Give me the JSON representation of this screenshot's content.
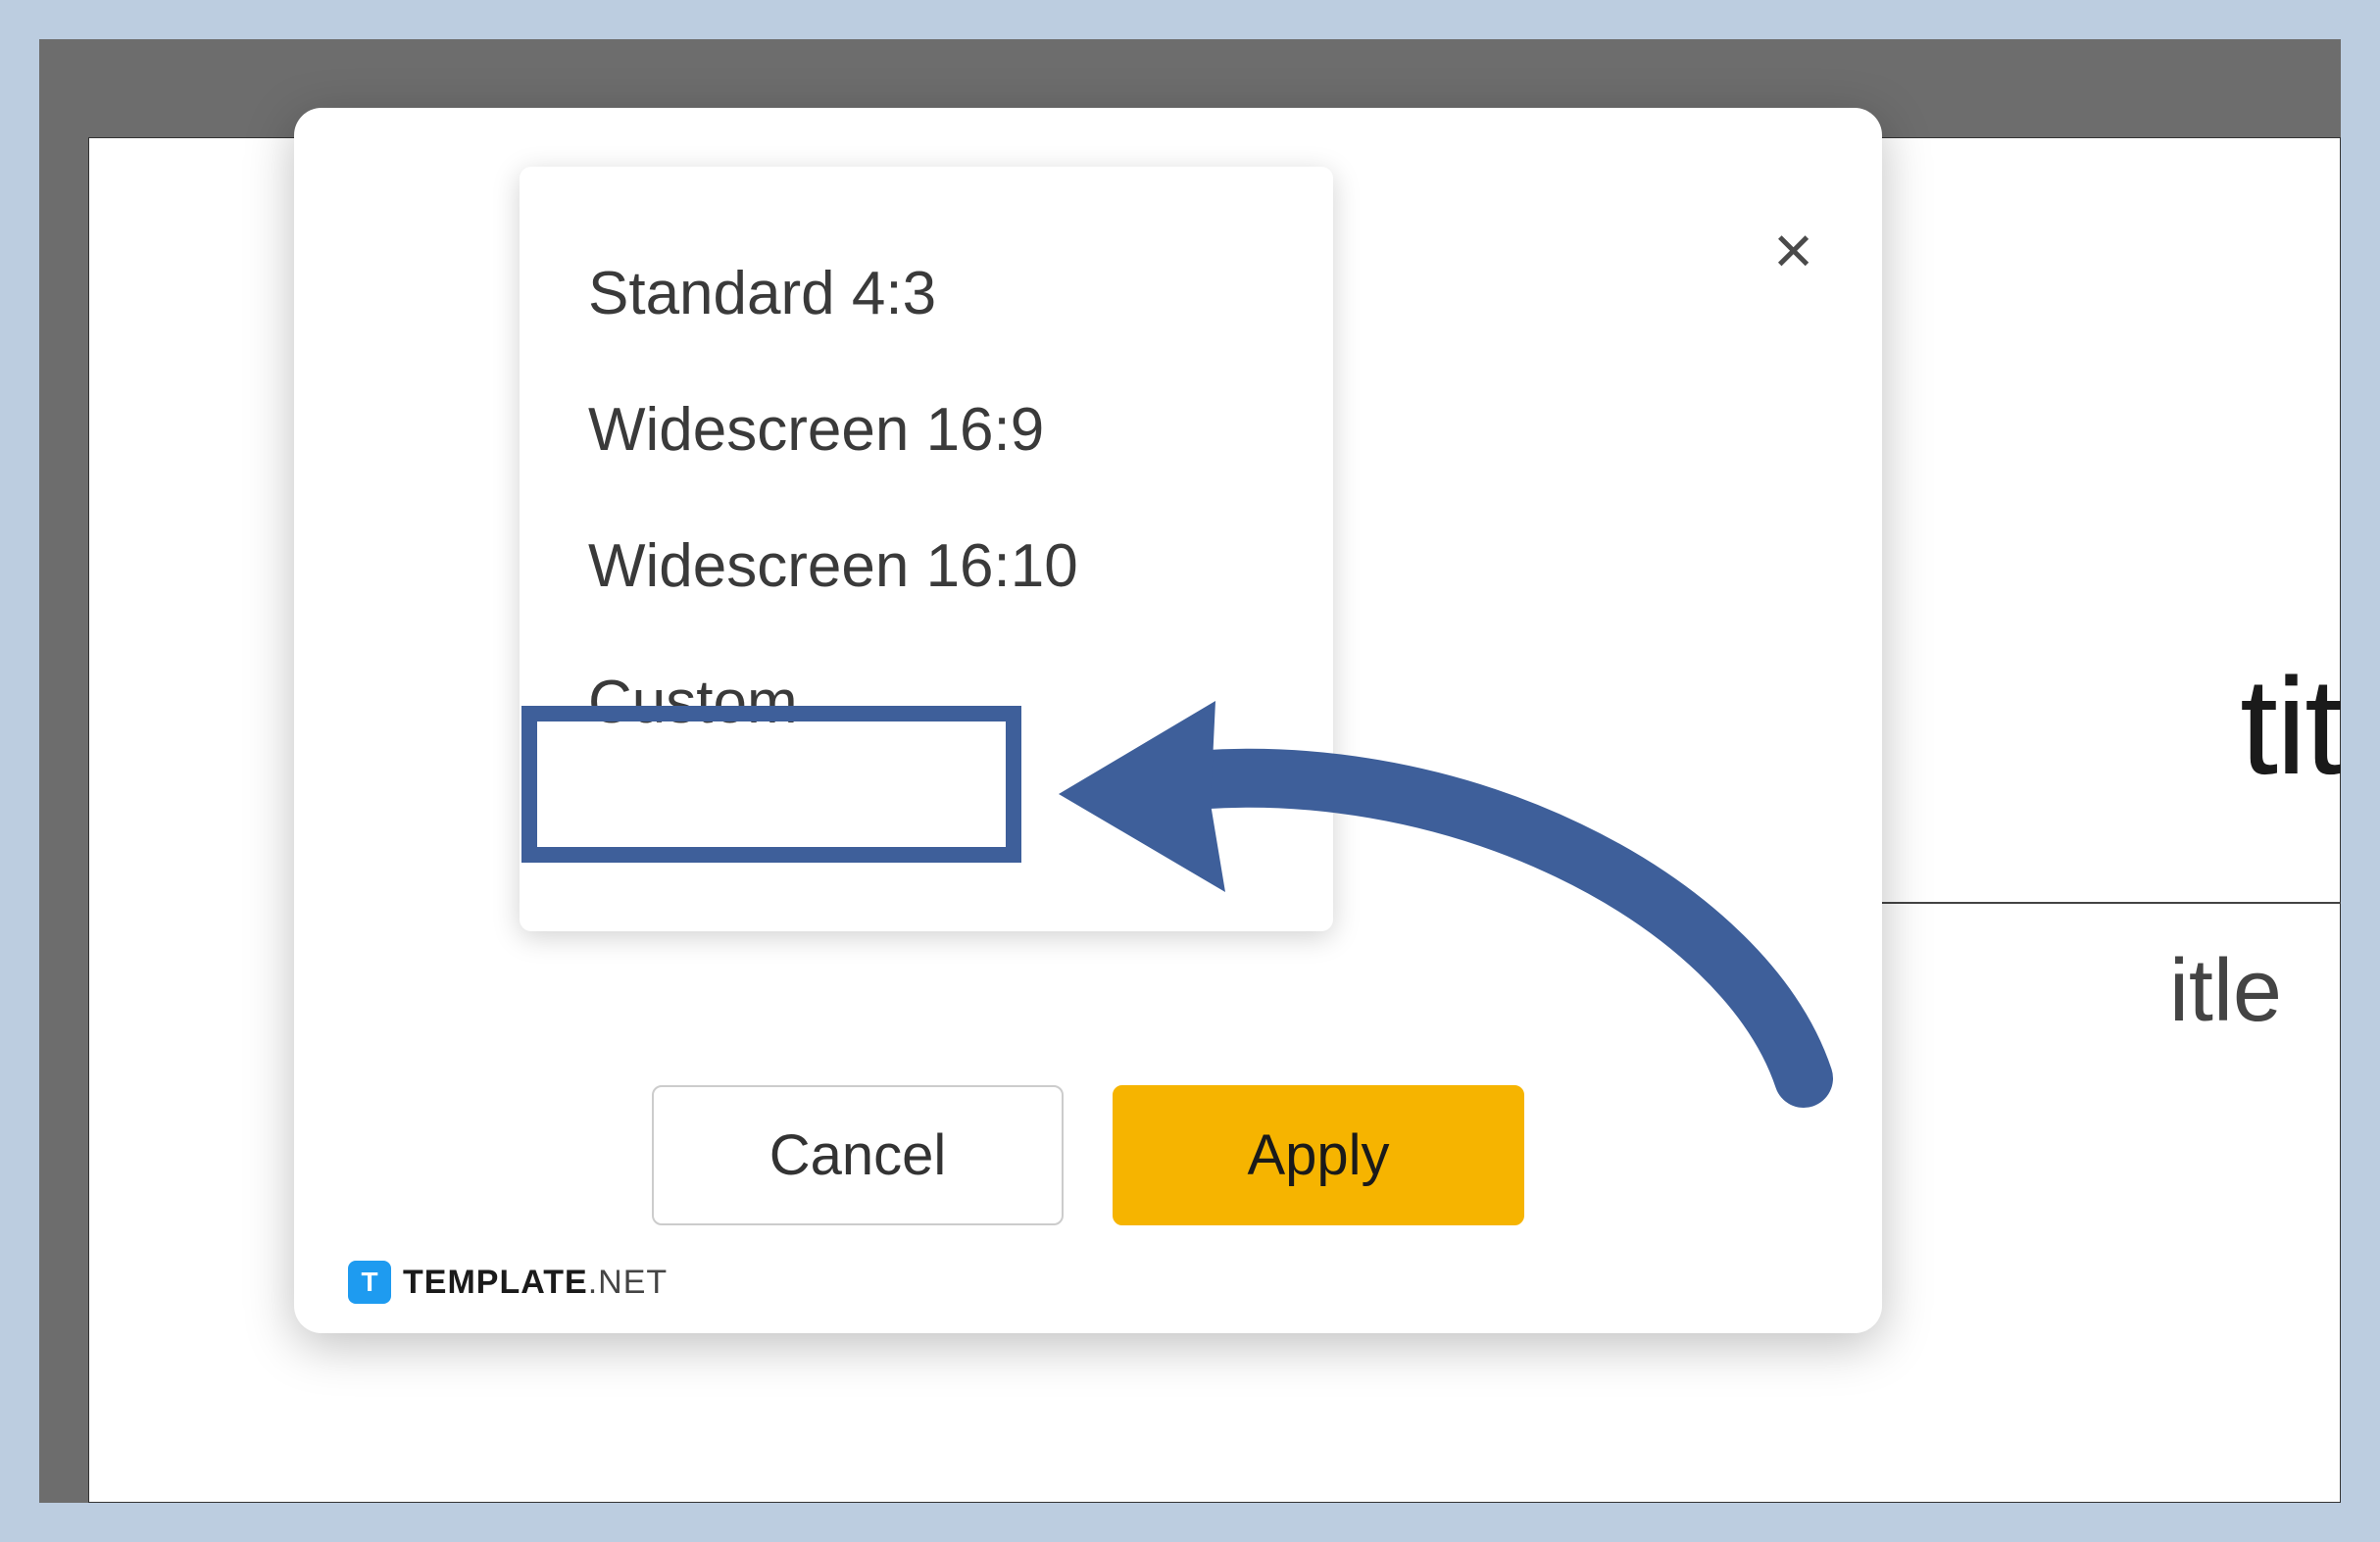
{
  "dropdown": {
    "options": [
      "Standard 4:3",
      "Widescreen 16:9",
      "Widescreen 16:10",
      "Custom"
    ]
  },
  "dialog": {
    "cancel_label": "Cancel",
    "apply_label": "Apply",
    "close_label": "×"
  },
  "background": {
    "title_fragment": "tit",
    "subtitle_fragment": "itle"
  },
  "watermark": {
    "icon_letter": "T",
    "brand_bold": "TEMPLATE",
    "brand_ext": ".NET"
  },
  "annotation": {
    "highlight_target": "Custom",
    "arrow_color": "#3e5f9a"
  }
}
